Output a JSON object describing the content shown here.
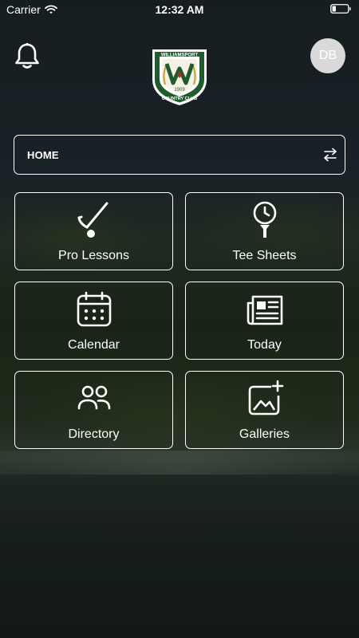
{
  "status_bar": {
    "carrier": "Carrier",
    "time": "12:32 AM"
  },
  "header": {
    "logo_text_top": "WILLIAMSPORT",
    "logo_letter": "W",
    "logo_year": "1909",
    "logo_text_bottom": "COUNTRY CLUB",
    "avatar_initials": "DB",
    "icons": {
      "left": "bell-icon",
      "right": "avatar"
    }
  },
  "nav": {
    "current": "HOME",
    "icon": "swap-arrows-icon"
  },
  "tiles": [
    {
      "label": "Pro Lessons",
      "icon": "golf-club-icon"
    },
    {
      "label": "Tee Sheets",
      "icon": "clock-tee-icon"
    },
    {
      "label": "Calendar",
      "icon": "calendar-icon"
    },
    {
      "label": "Today",
      "icon": "newspaper-icon"
    },
    {
      "label": "Directory",
      "icon": "people-icon"
    },
    {
      "label": "Galleries",
      "icon": "add-image-icon"
    }
  ],
  "colors": {
    "logo_green": "#1f5b2c",
    "logo_gold": "#c9a63a",
    "accent_red": "#b52a2a",
    "avatar_bg": "#d9d9d9"
  }
}
